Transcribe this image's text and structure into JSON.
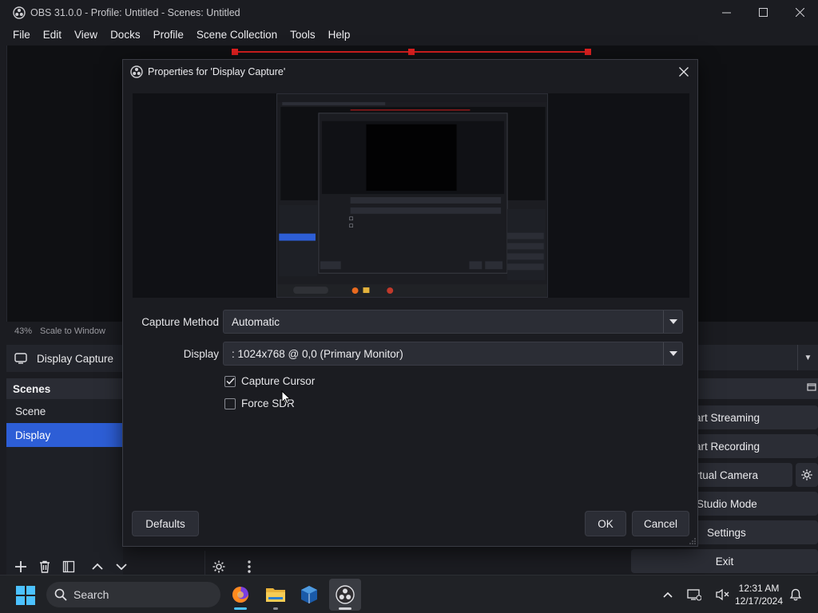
{
  "window": {
    "title": "OBS 31.0.0 - Profile: Untitled - Scenes: Untitled",
    "controls": [
      "minimize-icon",
      "maximize-icon",
      "close-icon"
    ]
  },
  "menu": [
    "File",
    "Edit",
    "View",
    "Docks",
    "Profile",
    "Scene Collection",
    "Tools",
    "Help"
  ],
  "preview_bar": {
    "zoom": "43%",
    "scale_mode": "Scale to Window"
  },
  "source_bar": {
    "label": "Display Capture",
    "icon": "monitor-icon"
  },
  "scenes_dock": {
    "header": "Scenes",
    "items": [
      {
        "label": "Scene",
        "selected": false
      },
      {
        "label": "Display",
        "selected": true
      }
    ],
    "toolbar_icons": [
      "add-icon",
      "trash-icon",
      "filter-icon",
      "chevron-up-icon",
      "chevron-down-icon"
    ]
  },
  "controls_dock": {
    "buttons": {
      "start_streaming": "art Streaming",
      "start_recording": "art Recording",
      "virtual_camera": "rtual Camera",
      "studio_mode": "Studio Mode",
      "settings": "Settings",
      "exit": "Exit"
    }
  },
  "dialog": {
    "title": "Properties for 'Display Capture'",
    "capture_method": {
      "label": "Capture Method",
      "value": "Automatic"
    },
    "display": {
      "label": "Display",
      "value": ": 1024x768 @ 0,0 (Primary Monitor)"
    },
    "checkboxes": [
      {
        "label": "Capture Cursor",
        "checked": true
      },
      {
        "label": "Force SDR",
        "checked": false
      }
    ],
    "buttons": {
      "defaults": "Defaults",
      "ok": "OK",
      "cancel": "Cancel"
    }
  },
  "taskbar": {
    "search_placeholder": "Search",
    "apps": [
      "firefox-icon",
      "file-explorer-icon",
      "virtualbox-icon",
      "obs-icon"
    ],
    "active_app": "obs-icon",
    "clock": {
      "time": "12:31 AM",
      "date": "12/17/2024"
    }
  },
  "colors": {
    "background": "#1b1c21",
    "selection": "#2d5ed6",
    "preview_outline": "#d21f1f",
    "button": "#2b2d35"
  }
}
